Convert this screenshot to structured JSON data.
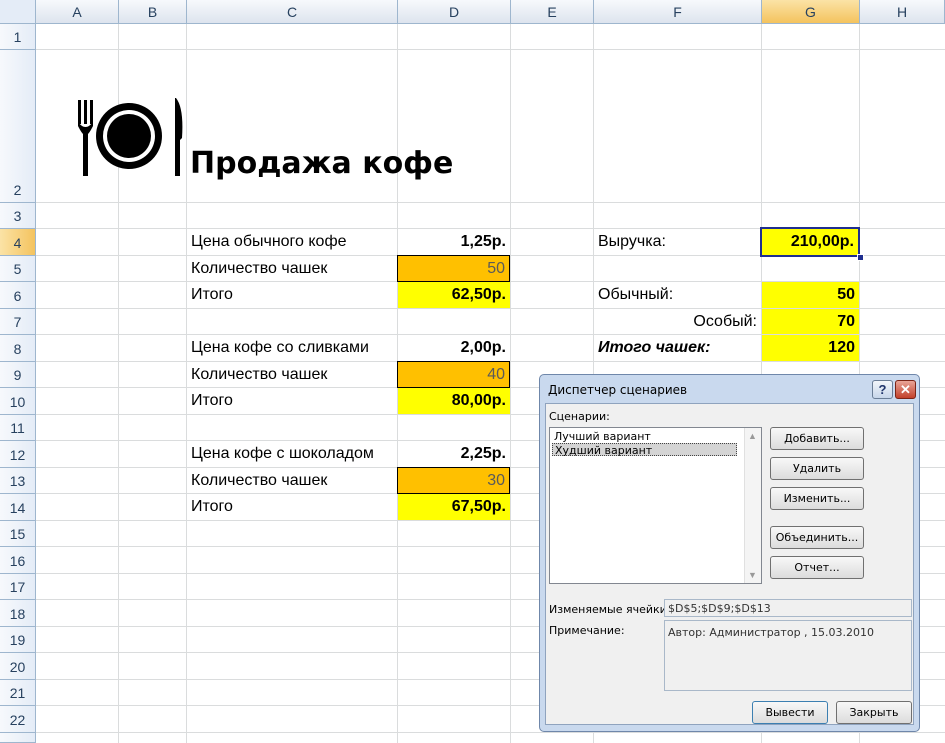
{
  "columns": [
    "A",
    "B",
    "C",
    "D",
    "E",
    "F",
    "G",
    "H"
  ],
  "rows": [
    "1",
    "2",
    "3",
    "4",
    "5",
    "6",
    "7",
    "8",
    "9",
    "10",
    "11",
    "12",
    "13",
    "14",
    "15",
    "16",
    "17",
    "18",
    "19",
    "20",
    "21",
    "22"
  ],
  "sheet": {
    "title": "Продажа кофе",
    "regular_price_label": "Цена обычного кофе",
    "regular_price": "1,25р.",
    "qty_label_1": "Количество чашек",
    "qty_1": "50",
    "total_label_1": "Итого",
    "total_1": "62,50р.",
    "cream_price_label": "Цена кофе со сливками",
    "cream_price": "2,00р.",
    "qty_label_2": "Количество чашек",
    "qty_2": "40",
    "total_label_2": "Итого",
    "total_2": "80,00р.",
    "choc_price_label": "Цена кофе с шоколадом",
    "choc_price": "2,25р.",
    "qty_label_3": "Количество чашек",
    "qty_3": "30",
    "total_label_3": "Итого",
    "total_3": "67,50р.",
    "revenue_label": "Выручка:",
    "revenue": "210,00р.",
    "regular_label": "Обычный:",
    "regular_count": "50",
    "special_label": "Особый:",
    "special_count": "70",
    "total_cups_label": "Итого чашек:",
    "total_cups": "120"
  },
  "dialog": {
    "title": "Диспетчер сценариев",
    "help_glyph": "?",
    "close_glyph": "✕",
    "scenarios_label": "Сценарии:",
    "scenarios": [
      "Лучший вариант",
      "Худший вариант"
    ],
    "add_button": "Добавить...",
    "delete_button": "Удалить",
    "edit_button": "Изменить...",
    "merge_button": "Объединить...",
    "report_button": "Отчет...",
    "changing_cells_label": "Изменяемые ячейки:",
    "changing_cells": "$D$5;$D$9;$D$13",
    "comment_label": "Примечание:",
    "comment": "Автор: Администратор , 15.03.2010",
    "show_button": "Вывести",
    "close_button": "Закрыть"
  }
}
